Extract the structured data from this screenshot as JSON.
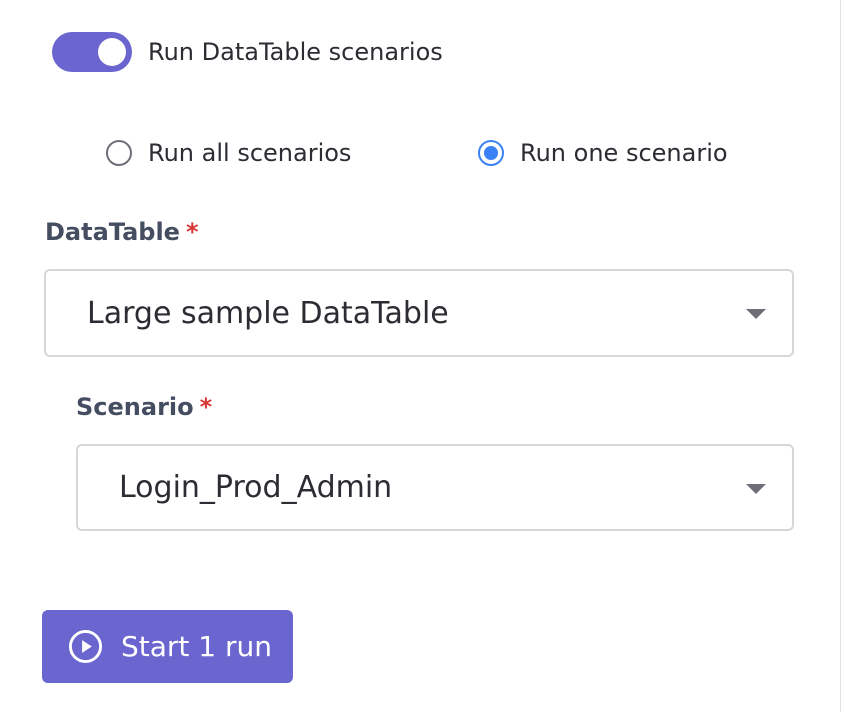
{
  "toggle": {
    "label": "Run DataTable scenarios",
    "checked": true,
    "color": "#6b66cf"
  },
  "run_mode": {
    "options": [
      {
        "label": "Run all scenarios",
        "selected": false
      },
      {
        "label": "Run one scenario",
        "selected": true
      }
    ],
    "selected_color": "#3b82f6"
  },
  "datatable_field": {
    "label": "DataTable",
    "required_mark": "*",
    "value": "Large sample DataTable",
    "caret_icon": "caret-down-icon"
  },
  "scenario_field": {
    "label": "Scenario",
    "required_mark": "*",
    "value": "Login_Prod_Admin",
    "caret_icon": "caret-down-icon"
  },
  "start_button": {
    "label": "Start 1 run",
    "icon": "play-circle-icon",
    "color": "#6b66cf"
  },
  "colors": {
    "required": "#d93636",
    "label": "#454d60",
    "text": "#2c2c33",
    "border": "#d6d6db"
  }
}
